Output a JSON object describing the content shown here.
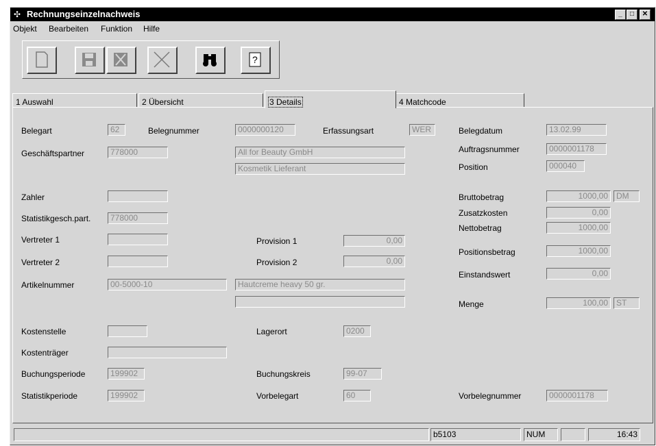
{
  "window": {
    "title": "Rechnungseinzelnachweis"
  },
  "menu": [
    "Objekt",
    "Bearbeiten",
    "Funktion",
    "Hilfe"
  ],
  "toolbar": {
    "buttons": [
      "new-document-icon",
      "save-icon",
      "delete-icon",
      "cancel-icon",
      "find-icon",
      "help-icon"
    ],
    "help_glyph": "?"
  },
  "tabs": [
    {
      "label": "1 Auswahl"
    },
    {
      "label": "2 Übersicht"
    },
    {
      "label": "3 Details"
    },
    {
      "label": "4 Matchcode"
    }
  ],
  "form": {
    "belegart": {
      "label": "Belegart",
      "value": "62"
    },
    "belegnummer": {
      "label": "Belegnummer",
      "value": "0000000120"
    },
    "erfassungsart": {
      "label": "Erfassungsart",
      "value": "WER"
    },
    "belegdatum": {
      "label": "Belegdatum",
      "value": "13.02.99"
    },
    "geschaeftspartner": {
      "label": "Geschäftspartner",
      "value": "778000"
    },
    "partner_name": "All for Beauty GmbH",
    "partner_desc": "Kosmetik Lieferant",
    "auftragsnummer": {
      "label": "Auftragsnummer",
      "value": "0000001178"
    },
    "position": {
      "label": "Position",
      "value": "000040"
    },
    "zahler": {
      "label": "Zahler",
      "value": ""
    },
    "bruttobetrag": {
      "label": "Bruttobetrag",
      "value": "1000,00",
      "currency": "DM"
    },
    "zusatzkosten": {
      "label": "Zusatzkosten",
      "value": "0,00"
    },
    "nettobetrag": {
      "label": "Nettobetrag",
      "value": "1000,00"
    },
    "statistikgesch": {
      "label": "Statistikgesch.part.",
      "value": "778000"
    },
    "vertreter1": {
      "label": "Vertreter 1",
      "value": ""
    },
    "provision1": {
      "label": "Provision 1",
      "value": "0,00"
    },
    "positionsbetrag": {
      "label": "Positionsbetrag",
      "value": "1000,00"
    },
    "vertreter2": {
      "label": "Vertreter 2",
      "value": ""
    },
    "provision2": {
      "label": "Provision 2",
      "value": "0,00"
    },
    "einstandswert": {
      "label": "Einstandswert",
      "value": "0,00"
    },
    "artikelnummer": {
      "label": "Artikelnummer",
      "value": "00-5000-10"
    },
    "artikel_desc1": "Hautcreme heavy 50 gr.",
    "artikel_desc2": "",
    "menge": {
      "label": "Menge",
      "value": "100,00",
      "unit": "ST"
    },
    "kostenstelle": {
      "label": "Kostenstelle",
      "value": ""
    },
    "lagerort": {
      "label": "Lagerort",
      "value": "0200"
    },
    "kostentraeger": {
      "label": "Kostenträger",
      "value": ""
    },
    "buchungsperiode": {
      "label": "Buchungsperiode",
      "value": "199902"
    },
    "buchungskreis": {
      "label": "Buchungskreis",
      "value": "99-07"
    },
    "statistikperiode": {
      "label": "Statistikperiode",
      "value": "199902"
    },
    "vorbelegart": {
      "label": "Vorbelegart",
      "value": "60"
    },
    "vorbelegnummer": {
      "label": "Vorbelegnummer",
      "value": "0000001178"
    }
  },
  "status": {
    "message": "",
    "db": "b5103",
    "num": "NUM",
    "blank": "",
    "time": "16:43"
  }
}
